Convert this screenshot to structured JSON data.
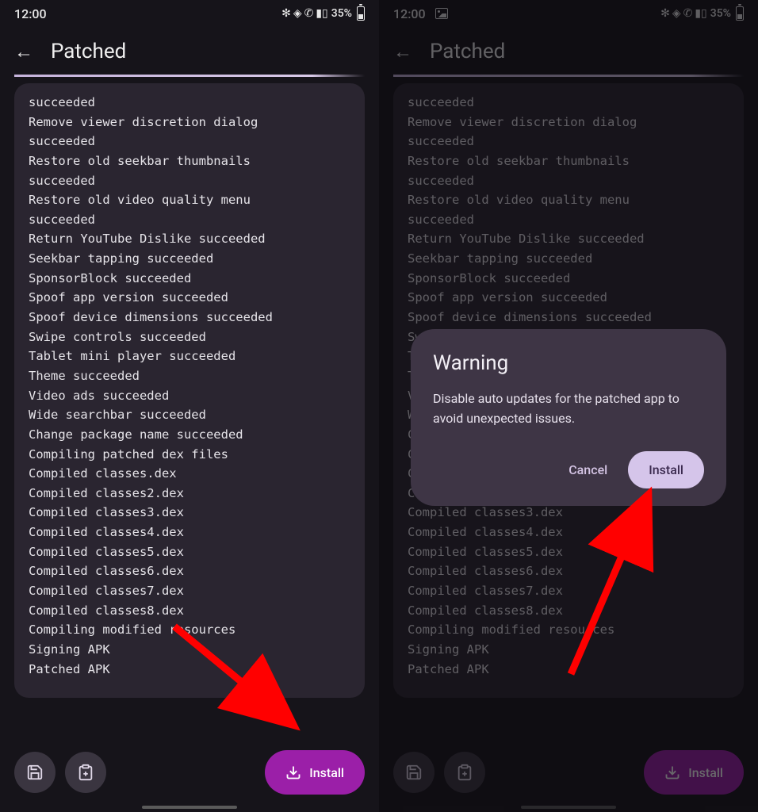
{
  "status": {
    "time": "12:00",
    "battery_pct": "35%"
  },
  "header": {
    "title": "Patched"
  },
  "log_lines": [
    "succeeded",
    "Remove viewer discretion dialog",
    "succeeded",
    "Restore old seekbar thumbnails",
    "succeeded",
    "Restore old video quality menu",
    "succeeded",
    "Return YouTube Dislike succeeded",
    "Seekbar tapping succeeded",
    "SponsorBlock succeeded",
    "Spoof app version succeeded",
    "Spoof device dimensions succeeded",
    "Swipe controls succeeded",
    "Tablet mini player succeeded",
    "Theme succeeded",
    "Video ads succeeded",
    "Wide searchbar succeeded",
    "Change package name succeeded",
    "Compiling patched dex files",
    "Compiled classes.dex",
    "Compiled classes2.dex",
    "Compiled classes3.dex",
    "Compiled classes4.dex",
    "Compiled classes5.dex",
    "Compiled classes6.dex",
    "Compiled classes7.dex",
    "Compiled classes8.dex",
    "Compiling modified resources",
    "Signing APK",
    "Patched APK"
  ],
  "buttons": {
    "install": "Install"
  },
  "dialog": {
    "title": "Warning",
    "body": "Disable auto updates for the patched app to avoid unexpected issues.",
    "cancel": "Cancel",
    "confirm": "Install"
  }
}
